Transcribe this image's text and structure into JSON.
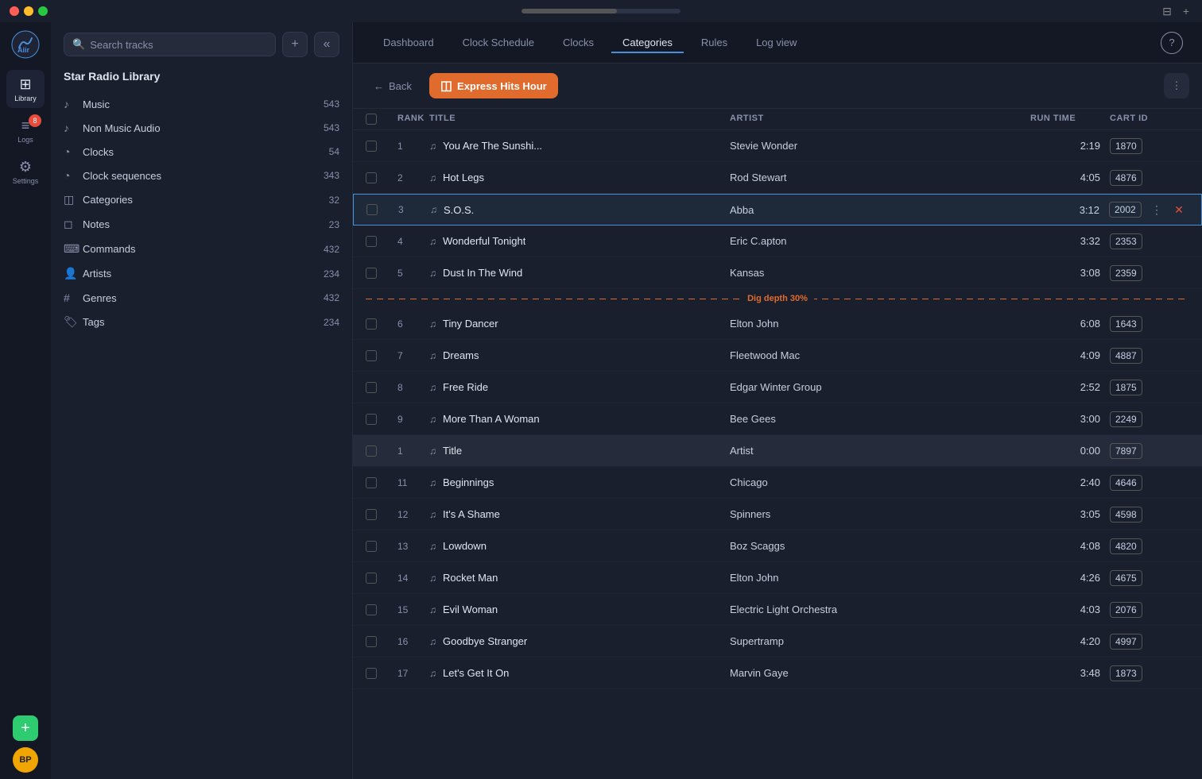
{
  "titlebar": {
    "dots": [
      "red",
      "yellow",
      "green"
    ],
    "actions": [
      "⊟",
      "+"
    ]
  },
  "iconBar": {
    "items": [
      {
        "id": "library",
        "icon": "⊞",
        "label": "Library",
        "active": true,
        "badge": null
      },
      {
        "id": "logs",
        "icon": "≡",
        "label": "Logs",
        "active": false,
        "badge": "8"
      },
      {
        "id": "settings",
        "icon": "⚙",
        "label": "Settings",
        "active": false,
        "badge": null
      }
    ],
    "add_label": "+",
    "avatar_label": "BP"
  },
  "nav": {
    "items": [
      {
        "id": "dashboard",
        "label": "Dashboard",
        "active": false
      },
      {
        "id": "clock-schedule",
        "label": "Clock Schedule",
        "active": false
      },
      {
        "id": "clocks",
        "label": "Clocks",
        "active": false
      },
      {
        "id": "categories",
        "label": "Categories",
        "active": true
      },
      {
        "id": "rules",
        "label": "Rules",
        "active": false
      },
      {
        "id": "log-view",
        "label": "Log view",
        "active": false
      }
    ],
    "help_label": "?"
  },
  "library": {
    "title": "Star Radio Library",
    "search_placeholder": "Search tracks",
    "items": [
      {
        "id": "music",
        "icon": "♪",
        "label": "Music",
        "count": "543",
        "type": "music"
      },
      {
        "id": "non-music-audio",
        "icon": "♪",
        "label": "Non Music Audio",
        "count": "543",
        "type": "music"
      },
      {
        "id": "clocks",
        "icon": "🕐",
        "label": "Clocks",
        "count": "54",
        "type": "clock"
      },
      {
        "id": "clock-sequences",
        "icon": "🕐",
        "label": "Clock sequences",
        "count": "343",
        "type": "clock"
      },
      {
        "id": "categories",
        "icon": "◫",
        "label": "Categories",
        "count": "32",
        "type": "category"
      },
      {
        "id": "notes",
        "icon": "◻",
        "label": "Notes",
        "count": "23",
        "type": "note"
      },
      {
        "id": "commands",
        "icon": "⌨",
        "label": "Commands",
        "count": "432",
        "type": "command"
      },
      {
        "id": "artists",
        "icon": "👤",
        "label": "Artists",
        "count": "234",
        "type": "artist"
      },
      {
        "id": "genres",
        "icon": "#",
        "label": "Genres",
        "count": "432",
        "type": "genre"
      },
      {
        "id": "tags",
        "icon": "🏷",
        "label": "Tags",
        "count": "234",
        "type": "tag"
      }
    ]
  },
  "content": {
    "back_label": "Back",
    "category_name": "Express Hits Hour",
    "table_columns": [
      "",
      "Rank",
      "Title",
      "Artist",
      "Run Time",
      "Cart ID"
    ],
    "dig_depth_label": "Dig depth 30%",
    "tracks": [
      {
        "rank": "1",
        "title": "You Are The Sunshi...",
        "artist": "Stevie Wonder",
        "runtime": "2:19",
        "cart_id": "1870",
        "selected": false
      },
      {
        "rank": "2",
        "title": "Hot Legs",
        "artist": "Rod Stewart",
        "runtime": "4:05",
        "cart_id": "4876",
        "selected": false
      },
      {
        "rank": "3",
        "title": "S.O.S.",
        "artist": "Abba",
        "runtime": "3:12",
        "cart_id": "2002",
        "selected": true
      },
      {
        "rank": "4",
        "title": "Wonderful Tonight",
        "artist": "Eric C.apton",
        "runtime": "3:32",
        "cart_id": "2353",
        "selected": false
      },
      {
        "rank": "5",
        "title": "Dust In The Wind",
        "artist": "Kansas",
        "runtime": "3:08",
        "cart_id": "2359",
        "selected": false
      }
    ],
    "tracks_below_dig": [
      {
        "rank": "6",
        "title": "Tiny Dancer",
        "artist": "Elton John",
        "runtime": "6:08",
        "cart_id": "1643",
        "selected": false
      },
      {
        "rank": "7",
        "title": "Dreams",
        "artist": "Fleetwood Mac",
        "runtime": "4:09",
        "cart_id": "4887",
        "selected": false
      },
      {
        "rank": "8",
        "title": "Free Ride",
        "artist": "Edgar Winter Group",
        "runtime": "2:52",
        "cart_id": "1875",
        "selected": false
      },
      {
        "rank": "9",
        "title": "More Than A Woman",
        "artist": "Bee Gees",
        "runtime": "3:00",
        "cart_id": "2249",
        "selected": false
      },
      {
        "rank": "1",
        "title": "Title",
        "artist": "Artist",
        "runtime": "0:00",
        "cart_id": "7897",
        "selected": false,
        "is_header": true
      },
      {
        "rank": "11",
        "title": "Beginnings",
        "artist": "Chicago",
        "runtime": "2:40",
        "cart_id": "4646",
        "selected": false
      },
      {
        "rank": "12",
        "title": "It's A Shame",
        "artist": "Spinners",
        "runtime": "3:05",
        "cart_id": "4598",
        "selected": false
      },
      {
        "rank": "13",
        "title": "Lowdown",
        "artist": "Boz Scaggs",
        "runtime": "4:08",
        "cart_id": "4820",
        "selected": false
      },
      {
        "rank": "14",
        "title": "Rocket Man",
        "artist": "Elton John",
        "runtime": "4:26",
        "cart_id": "4675",
        "selected": false
      },
      {
        "rank": "15",
        "title": "Evil Woman",
        "artist": "Electric Light Orchestra",
        "runtime": "4:03",
        "cart_id": "2076",
        "selected": false
      },
      {
        "rank": "16",
        "title": "Goodbye Stranger",
        "artist": "Supertramp",
        "runtime": "4:20",
        "cart_id": "4997",
        "selected": false
      },
      {
        "rank": "17",
        "title": "Let's Get It On",
        "artist": "Marvin Gaye",
        "runtime": "3:48",
        "cart_id": "1873",
        "selected": false
      }
    ]
  },
  "colors": {
    "accent": "#4a90d9",
    "orange": "#e06b2d",
    "green": "#2ecc71",
    "selected_row": "#1e2a3a",
    "selected_border": "#4a90d9"
  }
}
